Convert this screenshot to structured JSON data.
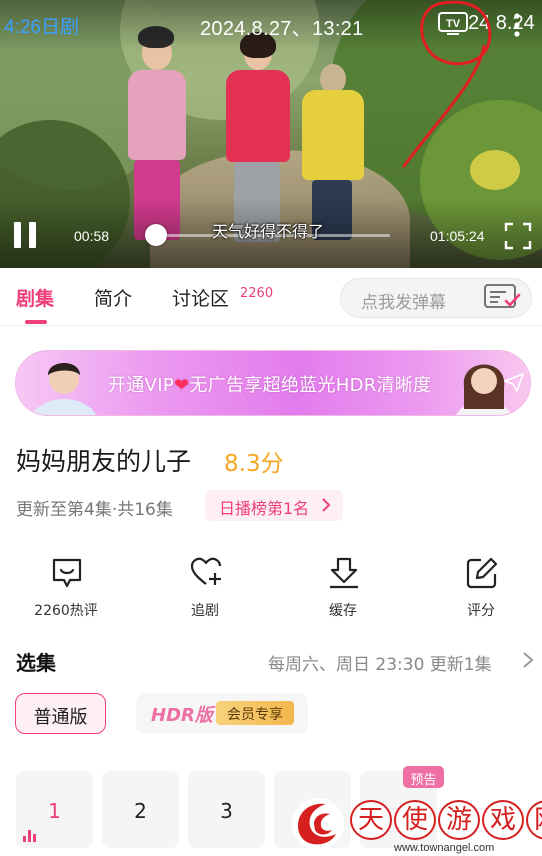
{
  "player": {
    "back_label": "4:26日剧",
    "timestamp": "2024.8.27、13:21",
    "tv_label": "TV",
    "timestamp_tail": "24 8.24",
    "subtitle": "天气好得不得了",
    "elapsed": "00:58",
    "duration": "01:05:24",
    "progress": 0.015,
    "icons": [
      "pause-icon",
      "fullscreen-icon",
      "tv-icon",
      "more-icon"
    ]
  },
  "tabs": {
    "items": [
      {
        "label": "剧集",
        "active": true
      },
      {
        "label": "简介",
        "active": false
      },
      {
        "label": "讨论区",
        "active": false
      }
    ],
    "discussion_count": "2260",
    "danmaku_placeholder": "点我发弹幕"
  },
  "vip_banner": {
    "text_before": "开通VIP",
    "heart": "❤",
    "text_after": "无广告享超绝蓝光HDR清晰度"
  },
  "show": {
    "title": "妈妈朋友的儿子",
    "score": "8.3分",
    "update_info": "更新至第4集·共16集",
    "rank_label": "日播榜第1名"
  },
  "actions": [
    {
      "label": "2260热评",
      "icon": "comment-icon"
    },
    {
      "label": "追剧",
      "icon": "heart-plus-icon"
    },
    {
      "label": "缓存",
      "icon": "download-icon"
    },
    {
      "label": "评分",
      "icon": "edit-icon"
    }
  ],
  "episodes": {
    "section_title": "选集",
    "schedule": "每周六、周日 23:30 更新1集",
    "versions": {
      "standard": "普通版",
      "hdr": "HDR版",
      "member_badge": "会员专享"
    },
    "items": [
      "1",
      "2",
      "3"
    ],
    "active_index": 0,
    "preview_badge": "预告"
  },
  "watermark": {
    "chars": [
      "天",
      "使",
      "游",
      "戏",
      "网"
    ],
    "url": "www.townangel.com"
  },
  "colors": {
    "accent": "#ee3f7c",
    "score": "#f5a623",
    "annotation": "#e02020"
  }
}
